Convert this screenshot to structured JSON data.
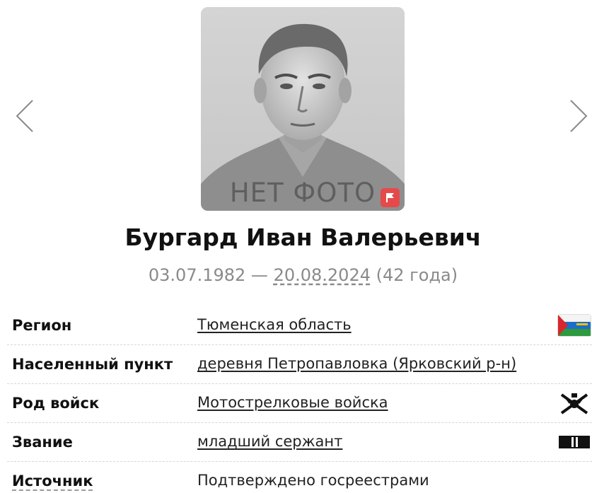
{
  "carousel": {
    "prev_icon": "chevron-left-icon",
    "next_icon": "chevron-right-icon"
  },
  "photo": {
    "placeholder_text": "НЕТ ФОТО",
    "flag_icon": "flag-icon",
    "flag_color": "#e54a4a"
  },
  "person": {
    "name": "Бургард Иван Валерьевич",
    "birth_date": "03.07.1982",
    "date_separator": " — ",
    "death_date": "20.08.2024",
    "age": " (42 года)"
  },
  "info_rows": [
    {
      "label": "Регион",
      "value": "Тюменская область",
      "is_link": true,
      "icon": "region-flag-icon"
    },
    {
      "label": "Населенный пункт",
      "value": "деревня Петропавловка (Ярковский р-н)",
      "is_link": true,
      "icon": ""
    },
    {
      "label": "Род войск",
      "value": "Мотострелковые войска",
      "is_link": true,
      "icon": "motor-rifle-emblem-icon"
    },
    {
      "label": "Звание",
      "value": "младший сержант",
      "is_link": true,
      "icon": "rank-insignia-icon"
    },
    {
      "label": "Источник",
      "value": "Подтверждено госреестрами",
      "is_link": false,
      "icon": ""
    }
  ],
  "colors": {
    "text": "#111111",
    "muted": "#8a8a8a",
    "accent_red": "#e54a4a",
    "divider": "#d6d6d6"
  }
}
